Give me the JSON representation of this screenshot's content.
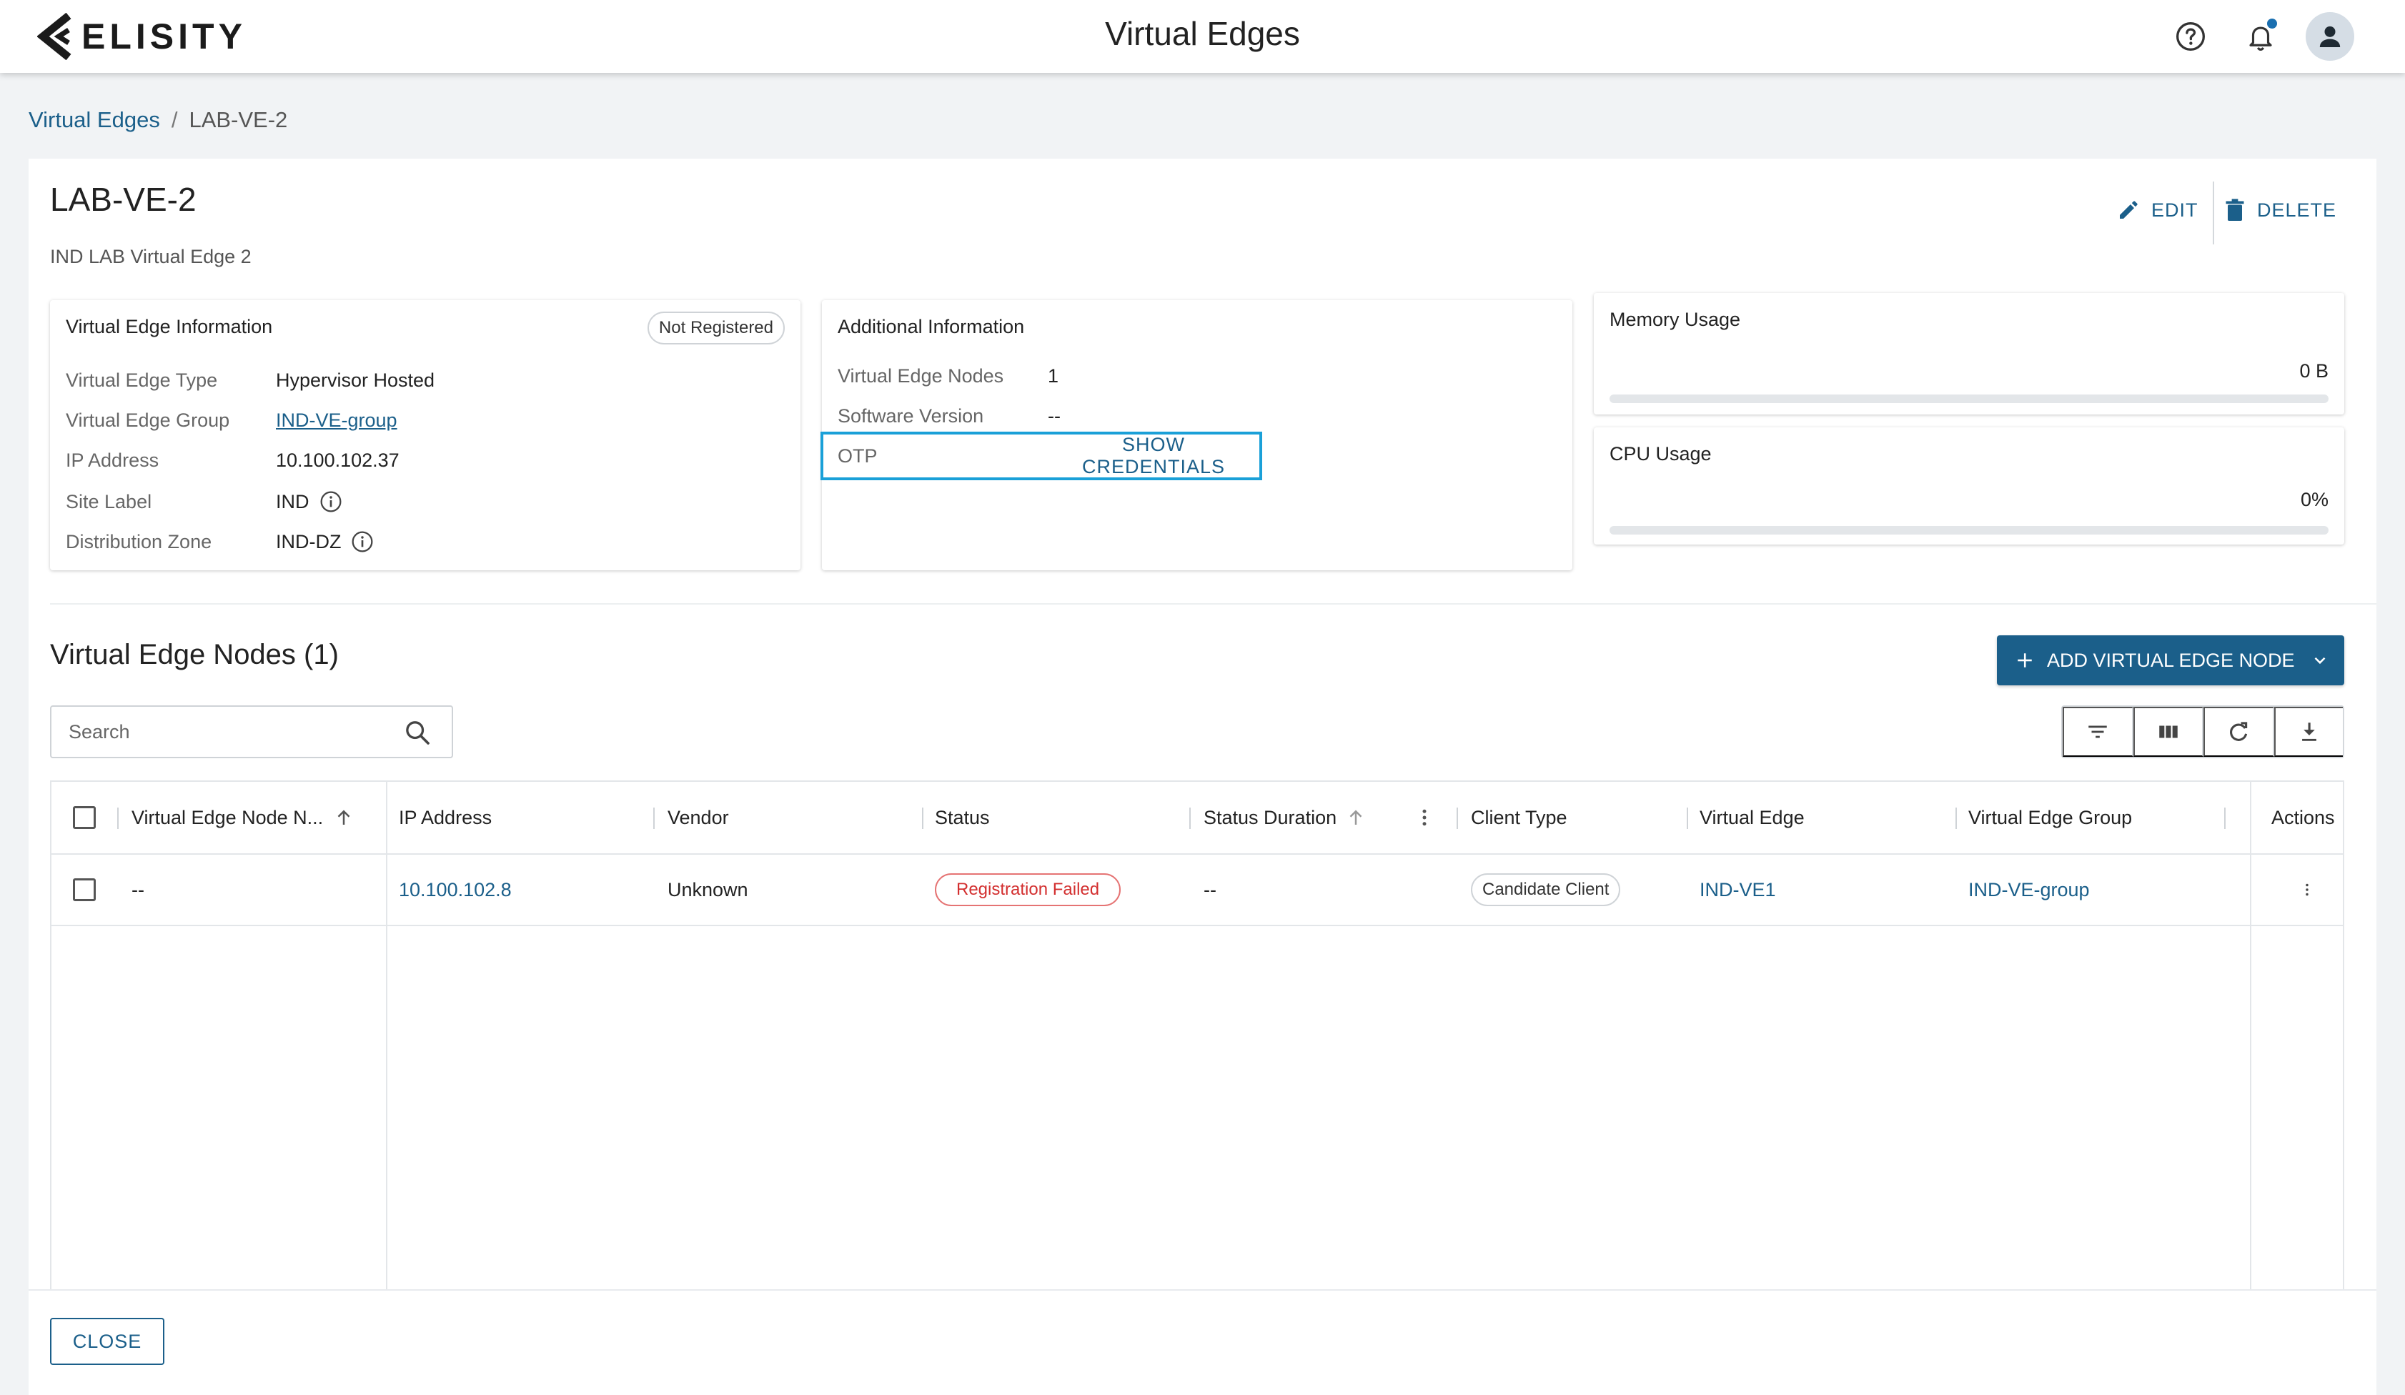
{
  "header": {
    "brand": "ELISITY",
    "title": "Virtual Edges",
    "icons": [
      "help-icon",
      "bell-icon",
      "user-icon"
    ]
  },
  "breadcrumb": {
    "parent": "Virtual Edges",
    "separator": "/",
    "current": "LAB-VE-2"
  },
  "detail": {
    "title": "LAB-VE-2",
    "description": "IND LAB Virtual Edge 2",
    "edit_label": "EDIT",
    "delete_label": "DELETE"
  },
  "ve_info": {
    "title": "Virtual Edge Information",
    "badge": "Not Registered",
    "rows": [
      {
        "label": "Virtual Edge Type",
        "value": "Hypervisor Hosted"
      },
      {
        "label": "Virtual Edge Group",
        "value": "IND-VE-group"
      },
      {
        "label": "IP Address",
        "value": "10.100.102.37"
      },
      {
        "label": "Site Label",
        "value": "IND"
      },
      {
        "label": "Distribution Zone",
        "value": "IND-DZ"
      }
    ]
  },
  "additional": {
    "title": "Additional Information",
    "rows": [
      {
        "label": "Virtual Edge Nodes",
        "value": "1"
      },
      {
        "label": "Software Version",
        "value": "--"
      }
    ],
    "otp_label": "OTP",
    "otp_button": "SHOW CREDENTIALS"
  },
  "memory": {
    "title": "Memory Usage",
    "value": "0 B",
    "fraction": 0
  },
  "cpu": {
    "title": "CPU Usage",
    "value": "0%",
    "fraction": 0
  },
  "nodes": {
    "title": "Virtual Edge Nodes (1)",
    "add_button": "ADD VIRTUAL EDGE NODE",
    "search_placeholder": "Search",
    "toolbar": [
      "filter-icon",
      "columns-icon",
      "refresh-icon",
      "download-icon"
    ],
    "columns": [
      "Virtual Edge Node N...",
      "IP Address",
      "Vendor",
      "Status",
      "Status Duration",
      "Client Type",
      "Virtual Edge",
      "Virtual Edge Group",
      "Actions"
    ],
    "rows": [
      {
        "name": "--",
        "ip": "10.100.102.8",
        "vendor": "Unknown",
        "status": "Registration Failed",
        "duration": "--",
        "client_type": "Candidate Client",
        "virtual_edge": "IND-VE1",
        "group": "IND-VE-group"
      }
    ]
  },
  "footer": {
    "close_label": "CLOSE"
  },
  "colors": {
    "primary": "#1b5f8a",
    "highlight": "#1aa0d8",
    "error": "#d32f2f",
    "background": "#f1f3f5"
  }
}
